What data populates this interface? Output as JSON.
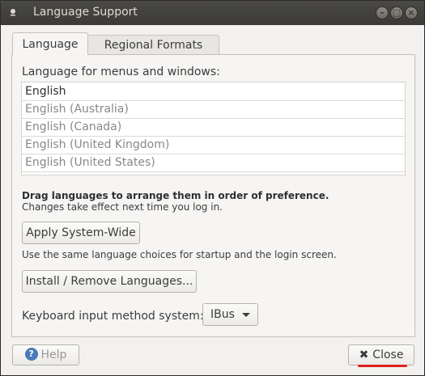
{
  "window": {
    "title": "Language Support"
  },
  "tabs": [
    {
      "label": "Language"
    },
    {
      "label": "Regional Formats"
    }
  ],
  "language": {
    "heading": "Language for menus and windows:",
    "items": [
      {
        "label": "English"
      },
      {
        "label": "English (Australia)"
      },
      {
        "label": "English (Canada)"
      },
      {
        "label": "English (United Kingdom)"
      },
      {
        "label": "English (United States)"
      }
    ],
    "drag_hint": "Drag languages to arrange them in order of preference.",
    "drag_note": "Changes take effect next time you log in.",
    "apply_label": "Apply System-Wide",
    "apply_note": "Use the same language choices for startup and the login screen.",
    "install_label": "Install / Remove Languages...",
    "keyboard_label": "Keyboard input method system:",
    "keyboard_value": "IBus"
  },
  "footer": {
    "help_label": "Help",
    "help_icon": "?",
    "close_label": "Close",
    "close_icon": "✖"
  },
  "colors": {
    "titlebar": "#3b3a36",
    "annotation_underline": "#e0211d"
  }
}
